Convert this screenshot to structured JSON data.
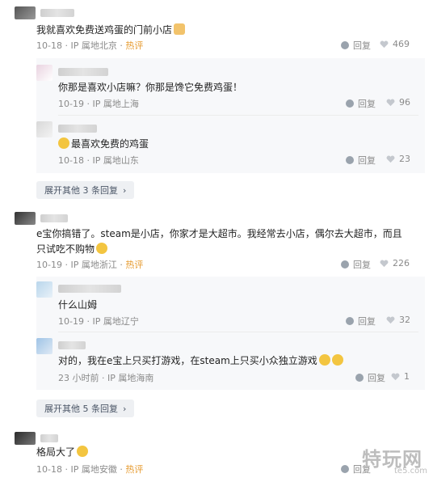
{
  "comments": [
    {
      "text": "我就喜欢免费送鸡蛋的门前小店",
      "date": "10-18",
      "ip": "IP 属地北京",
      "hot": "热评",
      "reply_label": "回复",
      "likes": "469"
    },
    {
      "text": "e宝你搞错了。steam是小店，你家才是大超市。我经常去小店，偶尔去大超市，而且只试吃不购物",
      "date": "10-19",
      "ip": "IP 属地浙江",
      "hot": "热评",
      "reply_label": "回复",
      "likes": "226"
    },
    {
      "text": "格局大了",
      "date": "10-18",
      "ip": "IP 属地安徽",
      "hot": "热评",
      "reply_label": "回复"
    }
  ],
  "replies": [
    {
      "text": "你那是喜欢小店嘛？你那是馋它免费鸡蛋！",
      "date": "10-19",
      "ip": "IP 属地上海",
      "reply_label": "回复",
      "likes": "96"
    },
    {
      "text": "最喜欢免费的鸡蛋",
      "date": "10-18",
      "ip": "IP 属地山东",
      "reply_label": "回复",
      "likes": "23"
    },
    {
      "text": "什么山姆",
      "date": "10-19",
      "ip": "IP 属地辽宁",
      "reply_label": "回复",
      "likes": "32"
    },
    {
      "text": "对的，我在e宝上只买打游戏，在steam上只买小众独立游戏",
      "date": "23 小时前",
      "ip": "IP 属地海南",
      "reply_label": "回复",
      "likes": "1"
    }
  ],
  "expand": [
    "展开其他 3 条回复",
    "展开其他 5 条回复"
  ],
  "watermark": {
    "brand": "特玩网",
    "domain": "te5.com"
  },
  "colors": {
    "hot": "#e69a2e",
    "meta": "#8a8a8a",
    "thread_bg": "#f7f8fa"
  }
}
